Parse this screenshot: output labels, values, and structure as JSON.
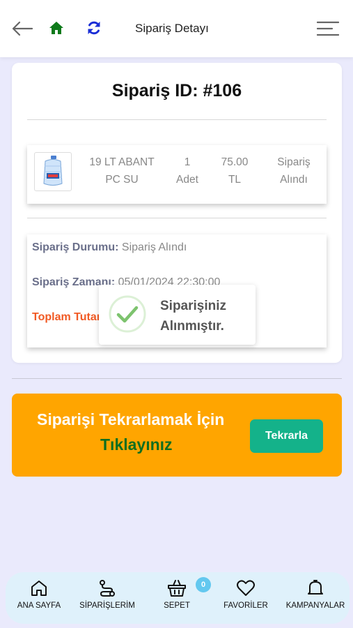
{
  "header": {
    "title": "Sipariş Detayı",
    "back_icon": "arrow-left-icon",
    "home_icon": "home-icon",
    "refresh_icon": "refresh-icon",
    "menu_icon": "hamburger-menu-icon",
    "home_color": "#0e7a1b",
    "refresh_color": "#1a2ed6"
  },
  "order": {
    "id_label": "Sipariş ID: #106",
    "item": {
      "name_line1": "19 LT ABANT",
      "name_line2": "PC SU",
      "qty_line1": "1",
      "qty_line2": "Adet",
      "price_line1": "75.00",
      "price_line2": "TL",
      "status_line1": "Sipariş",
      "status_line2": "Alındı"
    },
    "status_label": "Sipariş Durumu:",
    "status_value": "Sipariş Alındı",
    "time_label": "Sipariş Zamanı:",
    "time_value": "05/01/2024 22:30:00",
    "total_label": "Toplam Tutar:"
  },
  "toast": {
    "line1": "Siparişiniz",
    "line2": "Alınmıştır.",
    "icon": "check-circle-icon"
  },
  "repeat": {
    "text_line1": "Siparişi Tekrarlamak İçin",
    "text_line2": "Tıklayınız",
    "button_label": "Tekrarla",
    "banner_color": "#ffa500",
    "button_color": "#14b28a"
  },
  "nav": {
    "items": [
      {
        "label": "ANA SAYFA",
        "icon": "home-icon"
      },
      {
        "label": "SİPARİŞLERİM",
        "icon": "route-icon"
      },
      {
        "label": "SEPET",
        "icon": "basket-icon"
      },
      {
        "label": "FAVORİLER",
        "icon": "heart-icon"
      },
      {
        "label": "KAMPANYALAR",
        "icon": "bell-icon"
      }
    ],
    "cart_badge": "0"
  }
}
